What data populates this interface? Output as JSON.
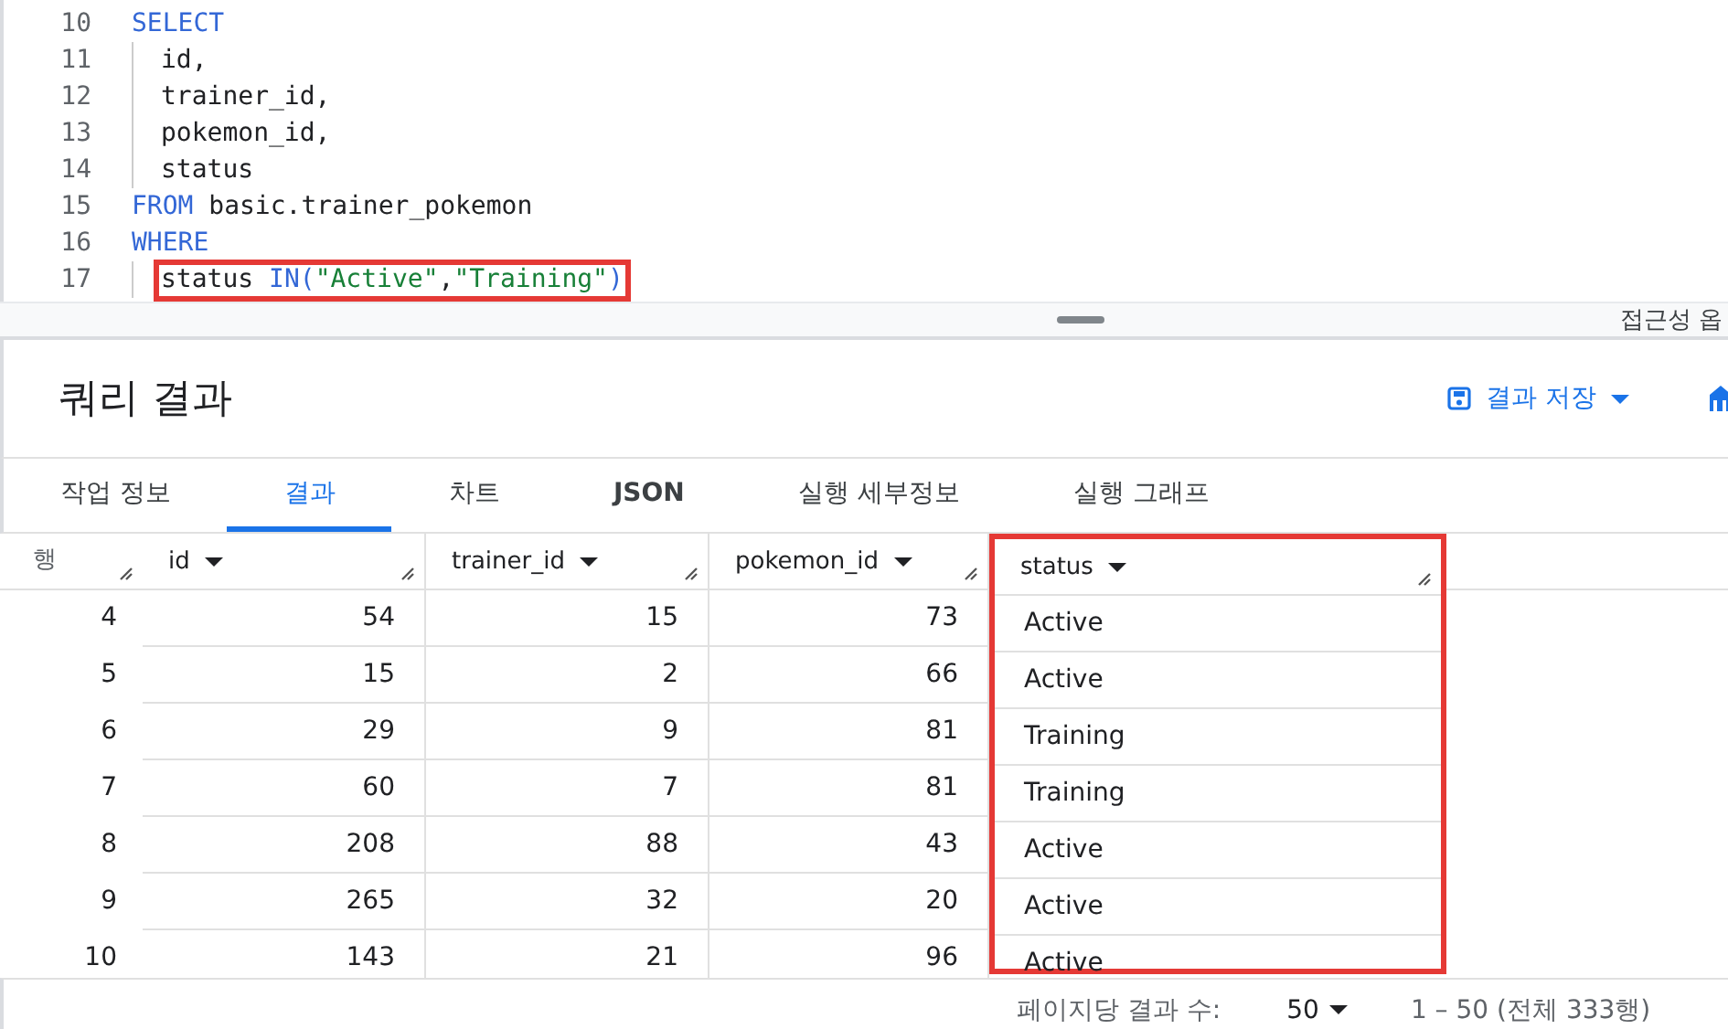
{
  "editor": {
    "lines": [
      {
        "number": "10",
        "indent": false,
        "highlighted": false,
        "tokens": [
          {
            "kind": "keyword",
            "text": "SELECT"
          }
        ]
      },
      {
        "number": "11",
        "indent": true,
        "highlighted": false,
        "tokens": [
          {
            "kind": "plain",
            "text": "id,"
          }
        ]
      },
      {
        "number": "12",
        "indent": true,
        "highlighted": false,
        "tokens": [
          {
            "kind": "plain",
            "text": "trainer_id,"
          }
        ]
      },
      {
        "number": "13",
        "indent": true,
        "highlighted": false,
        "tokens": [
          {
            "kind": "plain",
            "text": "pokemon_id,"
          }
        ]
      },
      {
        "number": "14",
        "indent": true,
        "highlighted": false,
        "tokens": [
          {
            "kind": "plain",
            "text": "status"
          }
        ]
      },
      {
        "number": "15",
        "indent": false,
        "highlighted": false,
        "tokens": [
          {
            "kind": "keyword",
            "text": "FROM"
          },
          {
            "kind": "plain",
            "text": " basic.trainer_pokemon"
          }
        ]
      },
      {
        "number": "16",
        "indent": false,
        "highlighted": false,
        "tokens": [
          {
            "kind": "keyword",
            "text": "WHERE"
          }
        ]
      },
      {
        "number": "17",
        "indent": true,
        "highlighted": true,
        "tokens": [
          {
            "kind": "plain",
            "text": "status "
          },
          {
            "kind": "keyword",
            "text": "IN("
          },
          {
            "kind": "string",
            "text": "\"Active\""
          },
          {
            "kind": "plain",
            "text": ","
          },
          {
            "kind": "string",
            "text": "\"Training\""
          },
          {
            "kind": "keyword",
            "text": ")"
          }
        ]
      }
    ]
  },
  "accessibility_hint": "접근성 옵",
  "results": {
    "title": "쿼리 결과",
    "save_button": "결과 저장",
    "tabs": [
      {
        "label": "작업 정보",
        "selected": false,
        "bold": false
      },
      {
        "label": "결과",
        "selected": true,
        "bold": false
      },
      {
        "label": "차트",
        "selected": false,
        "bold": false
      },
      {
        "label": "JSON",
        "selected": false,
        "bold": true
      },
      {
        "label": "실행 세부정보",
        "selected": false,
        "bold": false
      },
      {
        "label": "실행 그래프",
        "selected": false,
        "bold": false
      }
    ]
  },
  "table": {
    "row_header": "행",
    "columns": [
      {
        "name": "id",
        "kind": "number",
        "highlighted": false
      },
      {
        "name": "trainer_id",
        "kind": "number",
        "highlighted": false
      },
      {
        "name": "pokemon_id",
        "kind": "number",
        "highlighted": false
      },
      {
        "name": "status",
        "kind": "text",
        "highlighted": true
      }
    ],
    "rows": [
      {
        "row": "4",
        "cells": [
          "54",
          "15",
          "73",
          "Active"
        ]
      },
      {
        "row": "5",
        "cells": [
          "15",
          "2",
          "66",
          "Active"
        ]
      },
      {
        "row": "6",
        "cells": [
          "29",
          "9",
          "81",
          "Training"
        ]
      },
      {
        "row": "7",
        "cells": [
          "60",
          "7",
          "81",
          "Training"
        ]
      },
      {
        "row": "8",
        "cells": [
          "208",
          "88",
          "43",
          "Active"
        ]
      },
      {
        "row": "9",
        "cells": [
          "265",
          "32",
          "20",
          "Active"
        ]
      },
      {
        "row": "10",
        "cells": [
          "143",
          "21",
          "96",
          "Active"
        ]
      }
    ]
  },
  "pagination": {
    "label": "페이지당 결과 수:",
    "page_size": "50",
    "range": "1 – 50 (전체 333행)"
  }
}
